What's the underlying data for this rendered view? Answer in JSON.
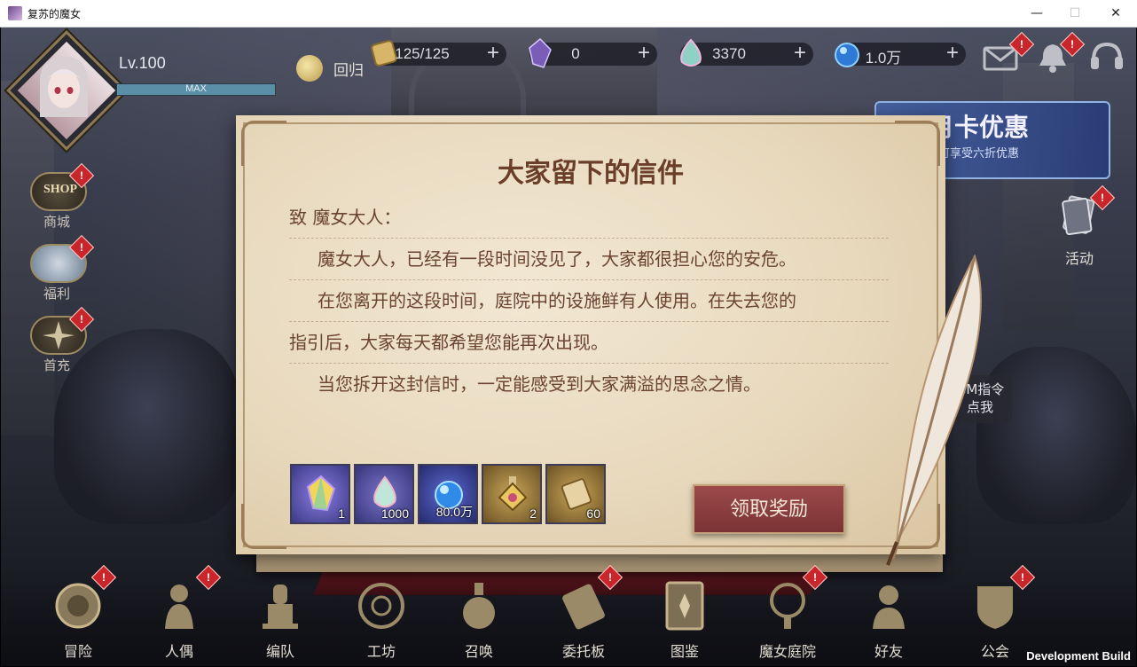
{
  "window": {
    "title": "复苏的魔女",
    "minimize": "—",
    "maximize": "☐",
    "close": "✕"
  },
  "player": {
    "level": "Lv.100",
    "exp_text": "MAX"
  },
  "top": {
    "return_label": "回归",
    "resources": [
      {
        "icon": "stamina-scroll-icon",
        "value": "125/125"
      },
      {
        "icon": "crystal-prism-icon",
        "value": "0"
      },
      {
        "icon": "rainbow-gem-icon",
        "value": "3370"
      },
      {
        "icon": "blue-orb-icon",
        "value": "1.0万"
      }
    ],
    "plus": "+",
    "mail_badge": "!",
    "notice_badge": "!"
  },
  "left_menu": [
    {
      "label": "商城",
      "badge": "!",
      "icon_text": "SHOP"
    },
    {
      "label": "福利",
      "badge": "!"
    },
    {
      "label": "首充",
      "badge": "!"
    }
  ],
  "right": {
    "banner_title": "月卡优惠",
    "banner_sub": "可享受六折优惠",
    "activity_label": "活动",
    "activity_badge": "!",
    "gm_line1": "GM指令",
    "gm_line2": "点我"
  },
  "letter": {
    "title": "大家留下的信件",
    "salutation": "致 魔女大人：",
    "lines": [
      "魔女大人，已经有一段时间没见了，大家都很担心您的安危。",
      "在您离开的这段时间，庭院中的设施鲜有人使用。在失去您的",
      "指引后，大家每天都希望您能再次出现。",
      "当您拆开这封信时，一定能感受到大家满溢的思念之情。"
    ],
    "rewards": [
      {
        "icon": "prism-crystal-icon",
        "qty": "1",
        "bg": "#5a5a9e"
      },
      {
        "icon": "rainbow-drop-icon",
        "qty": "1000",
        "bg": "#4a4a86"
      },
      {
        "icon": "blue-orb-icon",
        "qty": "80.0万",
        "bg": "#3c3f80"
      },
      {
        "icon": "potion-icon",
        "qty": "2",
        "bg": "#8a6a2e"
      },
      {
        "icon": "scroll-icon",
        "qty": "60",
        "bg": "#8a6a2e"
      }
    ],
    "claim_label": "领取奖励"
  },
  "bottom_nav": [
    {
      "label": "冒险",
      "icon": "adventure-icon",
      "badge": "!"
    },
    {
      "label": "人偶",
      "icon": "doll-icon",
      "badge": "!"
    },
    {
      "label": "编队",
      "icon": "chess-icon",
      "badge": ""
    },
    {
      "label": "工坊",
      "icon": "workshop-icon",
      "badge": ""
    },
    {
      "label": "召唤",
      "icon": "summon-icon",
      "badge": ""
    },
    {
      "label": "委托板",
      "icon": "commission-icon",
      "badge": "!"
    },
    {
      "label": "图鉴",
      "icon": "codex-icon",
      "badge": ""
    },
    {
      "label": "魔女庭院",
      "icon": "garden-icon",
      "badge": "!"
    },
    {
      "label": "好友",
      "icon": "friends-icon",
      "badge": ""
    },
    {
      "label": "公会",
      "icon": "guild-icon",
      "badge": "!"
    }
  ],
  "dev_build": "Development Build"
}
